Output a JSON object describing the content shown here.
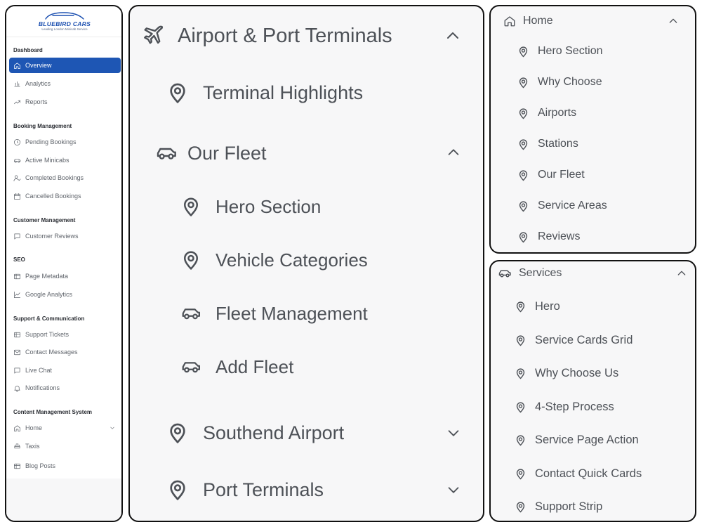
{
  "sidebar": {
    "brand": "BLUEBIRD CARS",
    "tagline": "Leading London Minicab Service",
    "sections": [
      {
        "heading": "Dashboard",
        "items": [
          {
            "label": "Overview",
            "icon": "home-icon",
            "active": true
          },
          {
            "label": "Analytics",
            "icon": "bar-chart-icon"
          },
          {
            "label": "Reports",
            "icon": "trend-icon"
          }
        ]
      },
      {
        "heading": "Booking Management",
        "items": [
          {
            "label": "Pending Bookings",
            "icon": "clock-icon"
          },
          {
            "label": "Active Minicabs",
            "icon": "car-icon"
          },
          {
            "label": "Completed Bookings",
            "icon": "user-check-icon"
          },
          {
            "label": "Cancelled Bookings",
            "icon": "calendar-icon"
          }
        ]
      },
      {
        "heading": "Customer Management",
        "items": [
          {
            "label": "Customer Reviews",
            "icon": "message-icon"
          }
        ]
      },
      {
        "heading": "SEO",
        "items": [
          {
            "label": "Page Metadata",
            "icon": "ticket-icon"
          },
          {
            "label": "Google Analytics",
            "icon": "line-chart-icon"
          }
        ]
      },
      {
        "heading": "Support & Communication",
        "items": [
          {
            "label": "Support Tickets",
            "icon": "ticket-icon"
          },
          {
            "label": "Contact Messages",
            "icon": "mail-icon"
          },
          {
            "label": "Live Chat",
            "icon": "message-icon"
          },
          {
            "label": "Notifications",
            "icon": "bell-icon"
          }
        ]
      },
      {
        "heading": "Content Management System",
        "items": [
          {
            "label": "Home",
            "icon": "home-icon",
            "chevron": "down"
          },
          {
            "label": "Taxis",
            "icon": "taxi-icon"
          },
          {
            "label": "Blog Posts",
            "icon": "ticket-icon"
          }
        ]
      }
    ]
  },
  "airport_panel": {
    "title": "Airport & Port Terminals",
    "items": {
      "terminal_highlights": "Terminal Highlights",
      "our_fleet": "Our Fleet",
      "hero_section": "Hero Section",
      "vehicle_categories": "Vehicle Categories",
      "fleet_management": "Fleet Management",
      "add_fleet": "Add Fleet",
      "southend_airport": "Southend Airport",
      "port_terminals": "Port Terminals"
    }
  },
  "home_panel": {
    "title": "Home",
    "items": [
      "Hero Section",
      "Why Choose",
      "Airports",
      "Stations",
      "Our Fleet",
      "Service Areas",
      "Reviews"
    ]
  },
  "services_panel": {
    "title": "Services",
    "items": [
      "Hero",
      "Service Cards Grid",
      "Why Choose Us",
      "4-Step Process",
      "Service Page Action",
      "Contact Quick Cards",
      "Support Strip"
    ]
  },
  "colors": {
    "accent": "#1e56b4",
    "text": "#4d5157",
    "panel_bg": "#f7f7f8"
  }
}
